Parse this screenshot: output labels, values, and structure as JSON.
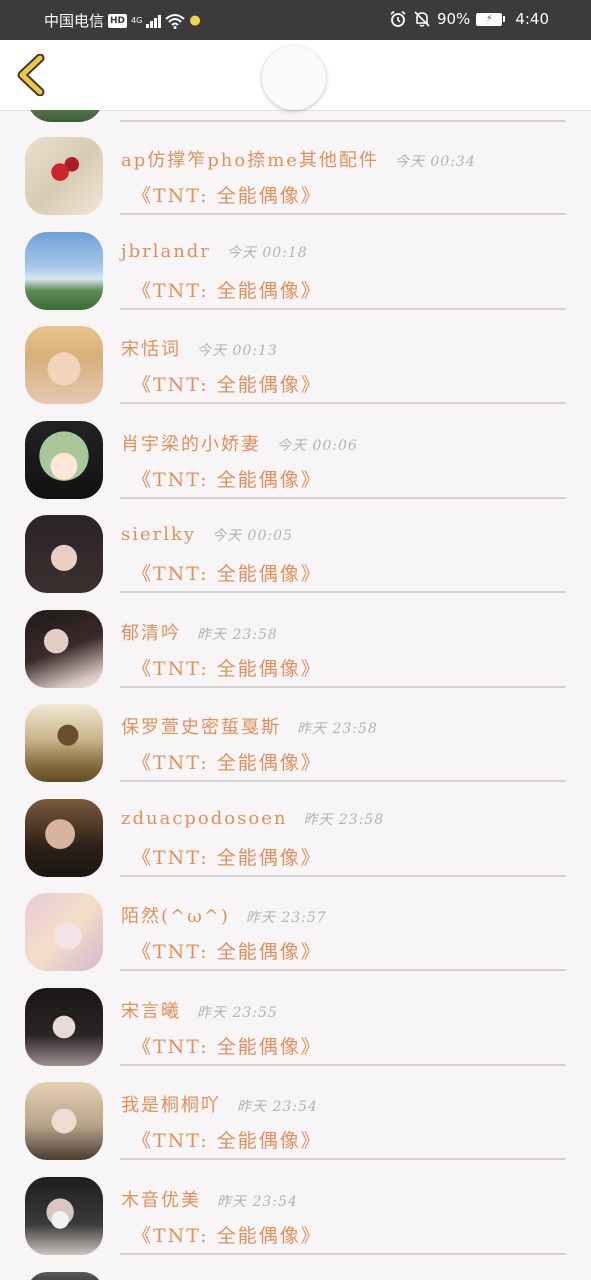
{
  "status_bar": {
    "carrier": "中国电信",
    "hd": "HD",
    "network": "4G",
    "battery_pct": "90%",
    "time": "4:40",
    "icons": [
      "hd-icon",
      "signal-icon",
      "wifi-icon",
      "bulb-icon",
      "alarm-icon",
      "mute-icon",
      "battery-icon"
    ]
  },
  "header": {
    "back_icon": "chevron-left-icon",
    "accent": "#f0c64a"
  },
  "colors": {
    "name": "#e0905e",
    "timestamp": "#b3b3b3",
    "divider": "#d6d2d2",
    "background": "#f7f5f5"
  },
  "rows": [
    {
      "name": "ap仿撑笮pho捺me其他配件",
      "time": "今天 00:34",
      "content": "《TNT: 全能偶像》",
      "avatar": "phone-case-cherry"
    },
    {
      "name": "jbrlandr",
      "time": "今天 00:18",
      "content": "《TNT: 全能偶像》",
      "avatar": "sky-landscape"
    },
    {
      "name": "宋恬词",
      "time": "今天 00:13",
      "content": "《TNT: 全能偶像》",
      "avatar": "blonde-girl"
    },
    {
      "name": "肖宇梁的小娇妻",
      "time": "今天 00:06",
      "content": "《TNT: 全能偶像》",
      "avatar": "anime-green-hair"
    },
    {
      "name": "sierlky",
      "time": "今天 00:05",
      "content": "《TNT: 全能偶像》",
      "avatar": "dark-hair-girl"
    },
    {
      "name": "郁清吟",
      "time": "昨天 23:58",
      "content": "《TNT: 全能偶像》",
      "avatar": "lying-girl"
    },
    {
      "name": "保罗萱史密蜇戛斯",
      "time": "昨天 23:58",
      "content": "《TNT: 全能偶像》",
      "avatar": "field-girl"
    },
    {
      "name": "zduacpodosoen",
      "time": "昨天 23:58",
      "content": "《TNT: 全能偶像》",
      "avatar": "smoking-girl"
    },
    {
      "name": "陌然(^ω^)",
      "time": "昨天 23:57",
      "content": "《TNT: 全能偶像》",
      "avatar": "anime-pink"
    },
    {
      "name": "宋言曦",
      "time": "昨天 23:55",
      "content": "《TNT: 全能偶像》",
      "avatar": "black-hair-girl"
    },
    {
      "name": "我是桐桐吖",
      "time": "昨天 23:54",
      "content": "《TNT: 全能偶像》",
      "avatar": "blonde-hands-girl"
    },
    {
      "name": "木音优美",
      "time": "昨天 23:54",
      "content": "《TNT: 全能偶像》",
      "avatar": "mask-girl"
    }
  ]
}
